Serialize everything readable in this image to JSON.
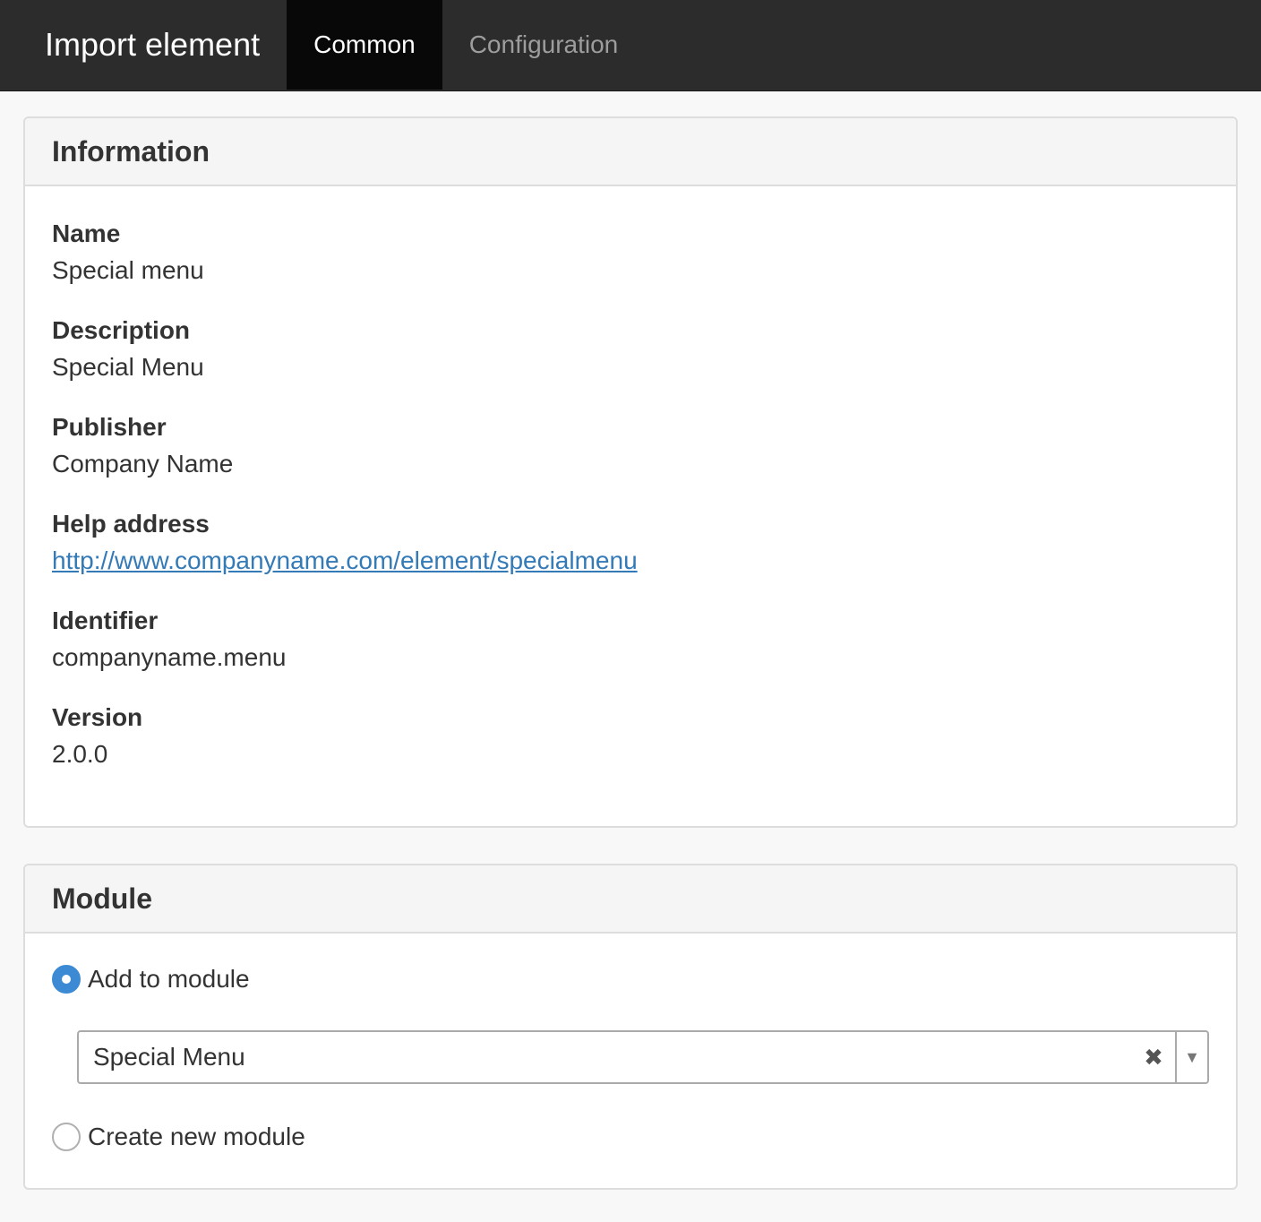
{
  "header": {
    "brand": "Import element",
    "tabs": [
      {
        "label": "Common",
        "active": true
      },
      {
        "label": "Configuration",
        "active": false
      }
    ]
  },
  "information": {
    "title": "Information",
    "fields": [
      {
        "label": "Name",
        "value": "Special menu"
      },
      {
        "label": "Description",
        "value": "Special Menu"
      },
      {
        "label": "Publisher",
        "value": "Company Name"
      },
      {
        "label": "Help address",
        "value": "http://www.companyname.com/element/specialmenu"
      },
      {
        "label": "Identifier",
        "value": "companyname.menu"
      },
      {
        "label": "Version",
        "value": "2.0.0"
      }
    ]
  },
  "module": {
    "title": "Module",
    "option_add": {
      "label": "Add to module",
      "checked": true
    },
    "select": {
      "value": "Special Menu",
      "clear_icon": "close-icon",
      "arrow_icon": "triangle-down-icon"
    },
    "option_create": {
      "label": "Create new module",
      "checked": false
    }
  },
  "colors": {
    "navbar": "#2c2c2c",
    "active_tab": "#080808",
    "link": "#337ab7",
    "radio_checked": "#3c8ad3"
  }
}
